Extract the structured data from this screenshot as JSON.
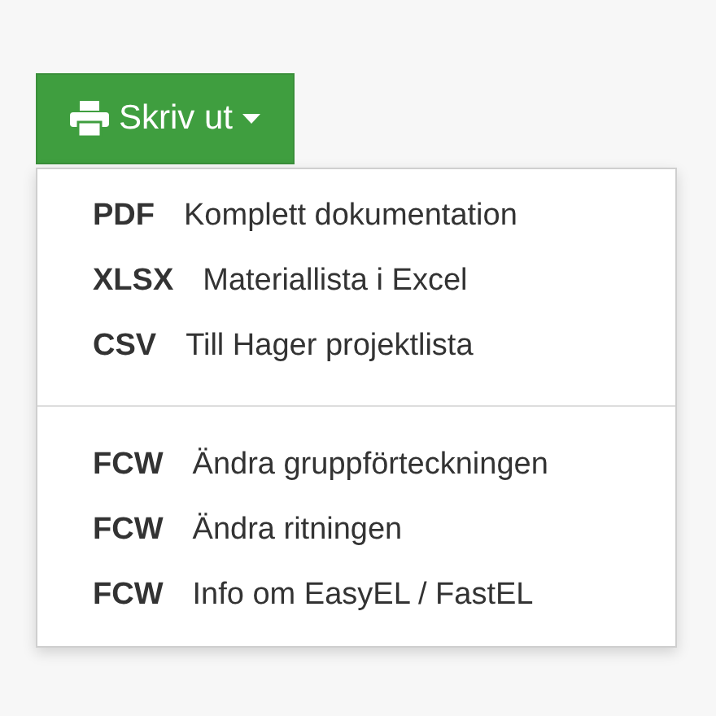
{
  "print_button": {
    "label": "Skriv ut",
    "expanded": true
  },
  "menu": {
    "groups": [
      {
        "items": [
          {
            "format": "PDF",
            "label": "Komplett dokumentation"
          },
          {
            "format": "XLSX",
            "label": "Materiallista i Excel"
          },
          {
            "format": "CSV",
            "label": "Till Hager projektlista"
          }
        ]
      },
      {
        "items": [
          {
            "format": "FCW",
            "label": "Ändra gruppförteckningen"
          },
          {
            "format": "FCW",
            "label": "Ändra ritningen"
          },
          {
            "format": "FCW",
            "label": "Info om EasyEL / FastEL"
          }
        ]
      }
    ]
  }
}
